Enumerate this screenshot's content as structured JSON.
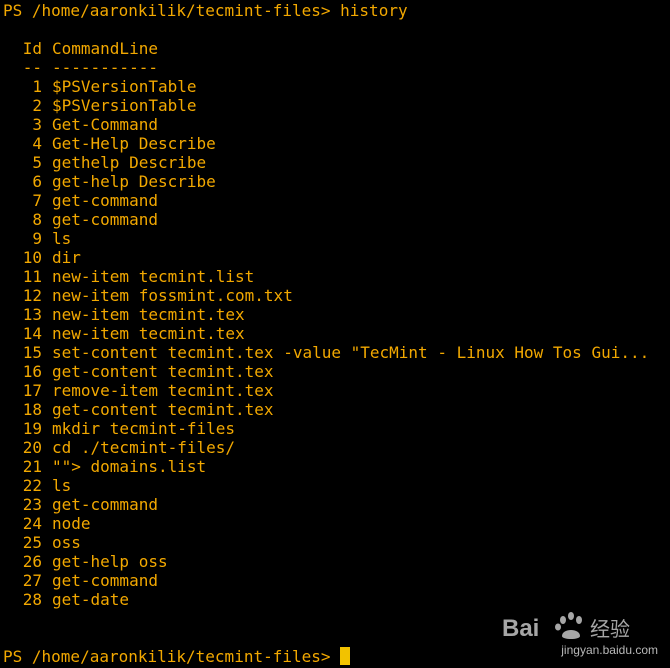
{
  "prompt": {
    "text": "PS /home/aaronkilik/tecmint-files> ",
    "command": "history"
  },
  "table": {
    "header_id": "Id",
    "header_cmd": "CommandLine",
    "sep_id": "--",
    "sep_cmd": "-----------",
    "rows": [
      {
        "id": "1",
        "cmd": "$PSVersionTable"
      },
      {
        "id": "2",
        "cmd": "$PSVersionTable"
      },
      {
        "id": "3",
        "cmd": "Get-Command"
      },
      {
        "id": "4",
        "cmd": "Get-Help Describe"
      },
      {
        "id": "5",
        "cmd": "gethelp Describe"
      },
      {
        "id": "6",
        "cmd": "get-help Describe"
      },
      {
        "id": "7",
        "cmd": "get-command"
      },
      {
        "id": "8",
        "cmd": "get-command"
      },
      {
        "id": "9",
        "cmd": "ls"
      },
      {
        "id": "10",
        "cmd": "dir"
      },
      {
        "id": "11",
        "cmd": "new-item tecmint.list"
      },
      {
        "id": "12",
        "cmd": "new-item fossmint.com.txt"
      },
      {
        "id": "13",
        "cmd": "new-item tecmint.tex"
      },
      {
        "id": "14",
        "cmd": "new-item tecmint.tex"
      },
      {
        "id": "15",
        "cmd": "set-content tecmint.tex -value \"TecMint - Linux How Tos Gui..."
      },
      {
        "id": "16",
        "cmd": "get-content tecmint.tex"
      },
      {
        "id": "17",
        "cmd": "remove-item tecmint.tex"
      },
      {
        "id": "18",
        "cmd": "get-content tecmint.tex"
      },
      {
        "id": "19",
        "cmd": "mkdir tecmint-files"
      },
      {
        "id": "20",
        "cmd": "cd ./tecmint-files/"
      },
      {
        "id": "21",
        "cmd": "\"\"> domains.list"
      },
      {
        "id": "22",
        "cmd": "ls"
      },
      {
        "id": "23",
        "cmd": "get-command"
      },
      {
        "id": "24",
        "cmd": "node"
      },
      {
        "id": "25",
        "cmd": "oss"
      },
      {
        "id": "26",
        "cmd": "get-help oss"
      },
      {
        "id": "27",
        "cmd": "get-command"
      },
      {
        "id": "28",
        "cmd": "get-date"
      }
    ]
  },
  "bottom_prompt": {
    "text": "PS /home/aaronkilik/tecmint-files> "
  },
  "watermark": {
    "brand": "Bai",
    "brand_suffix": "经验",
    "url": "jingyan.baidu.com"
  },
  "colors": {
    "background": "#000000",
    "text": "#f2a800",
    "cursor": "#f2c200"
  }
}
